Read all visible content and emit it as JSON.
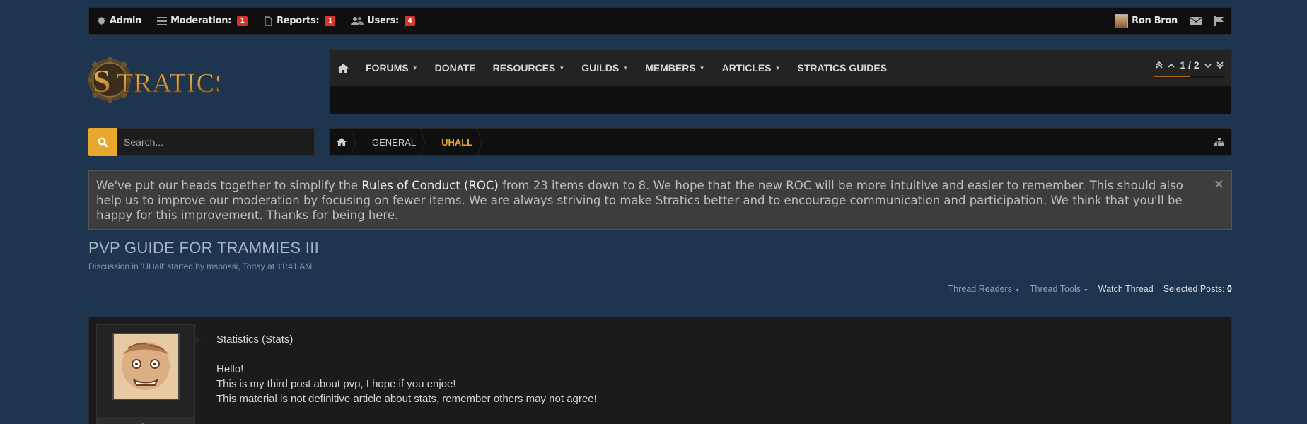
{
  "adminbar": {
    "admin_label": "Admin",
    "moderation_label": "Moderation:",
    "moderation_count": "1",
    "reports_label": "Reports:",
    "reports_count": "1",
    "users_label": "Users:",
    "users_count": "4",
    "username": "Ron Bron"
  },
  "logo": {
    "text": "STRATICS"
  },
  "nav": {
    "items": [
      {
        "label": "FORUMS",
        "caret": true
      },
      {
        "label": "DONATE",
        "caret": false
      },
      {
        "label": "RESOURCES",
        "caret": true
      },
      {
        "label": "GUILDS",
        "caret": true
      },
      {
        "label": "MEMBERS",
        "caret": true
      },
      {
        "label": "ARTICLES",
        "caret": true
      },
      {
        "label": "STRATICS GUIDES",
        "caret": false
      }
    ],
    "pager": {
      "text": "1 / 2",
      "progress": 0.5
    }
  },
  "search": {
    "placeholder": "Search..."
  },
  "breadcrumb": {
    "parent": "GENERAL",
    "current": "UHALL"
  },
  "notice": {
    "before": "We've put our heads together to simplify the ",
    "link": "Rules of Conduct (ROC)",
    "after": " from 23 items down to 8. We hope that the new ROC will be more intuitive and easier to remember. This should also help us to improve our moderation by focusing on fewer items. We are always striving to make Stratics better and to encourage communication and participation. We think that you'll be happy for this improvement. Thanks for being here.",
    "close": "×"
  },
  "thread": {
    "title": "PVP GUIDE FOR TRAMMIES III",
    "meta": "Discussion in 'UHall' started by mspossi, Today at 11:41 AM."
  },
  "tools": {
    "readers": "Thread Readers",
    "tools": "Thread Tools",
    "watch": "Watch Thread",
    "selected_label": "Selected Posts:",
    "selected_count": "0"
  },
  "post": {
    "username": "mspossi",
    "heading": "Statistics (Stats)",
    "lines": [
      "Hello!",
      "This is my third post about pvp, I hope if you enjoe!",
      "This material is not definitive article about stats, remember others may not agree!"
    ]
  },
  "colors": {
    "accent": "#e8a82e",
    "badge": "#d8342b",
    "background": "#1d354f"
  }
}
